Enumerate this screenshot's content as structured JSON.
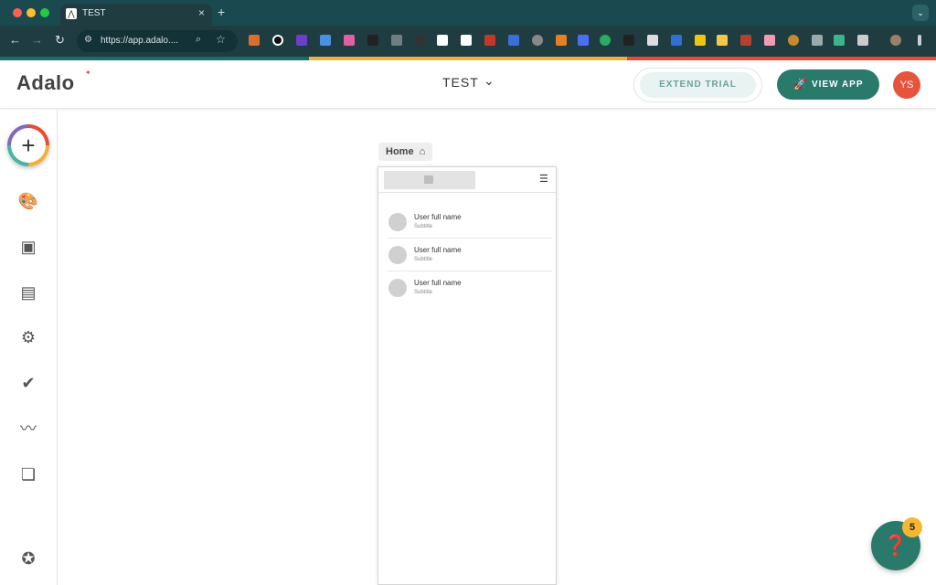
{
  "browser": {
    "tab_title": "TEST",
    "tab_close": "×",
    "new_tab": "+",
    "url": "https://app.adalo....",
    "tab_menu_icon": "chevron-down-icon"
  },
  "colors": {
    "accent": "#2a7a6c",
    "trial_text": "#6aa39b",
    "avatar_bg": "#e5543b",
    "badge": "#f5b731",
    "browser_chrome": "#1f3d41"
  },
  "header": {
    "logo": "Adalo",
    "project_name": "TEST",
    "extend_trial_label": "EXTEND TRIAL",
    "view_app_label": "VIEW APP",
    "user_initials": "YS"
  },
  "sidebar": {
    "items": [
      {
        "name": "add-icon"
      },
      {
        "name": "palette-icon"
      },
      {
        "name": "screens-icon"
      },
      {
        "name": "database-icon"
      },
      {
        "name": "settings-icon"
      },
      {
        "name": "publish-icon"
      },
      {
        "name": "analytics-icon"
      },
      {
        "name": "copy-app-icon"
      },
      {
        "name": "verified-icon"
      }
    ]
  },
  "canvas": {
    "screen_name": "Home",
    "list": [
      {
        "title": "User full name",
        "subtitle": "Subtitle"
      },
      {
        "title": "User full name",
        "subtitle": "Subtitle"
      },
      {
        "title": "User full name",
        "subtitle": "Subtitle"
      }
    ]
  },
  "help": {
    "badge_count": "5"
  }
}
